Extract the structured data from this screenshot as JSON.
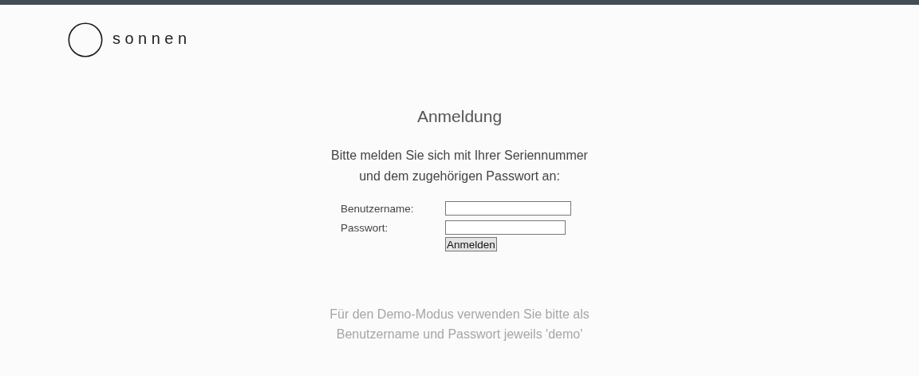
{
  "logo": {
    "text": "sonnen"
  },
  "title": "Anmeldung",
  "intro": [
    "Bitte melden Sie sich mit Ihrer Seriennummer",
    "und dem zugehörigen Passwort an:"
  ],
  "fields": [
    {
      "label": "Benutzername:",
      "kind": "text"
    },
    {
      "label": "Passwort:",
      "kind": "password"
    }
  ],
  "submit": {
    "label": "Anmelden"
  },
  "demo_note": [
    "Für den Demo-Modus verwenden Sie bitte als",
    "Benutzername und Passwort jeweils 'demo'"
  ]
}
